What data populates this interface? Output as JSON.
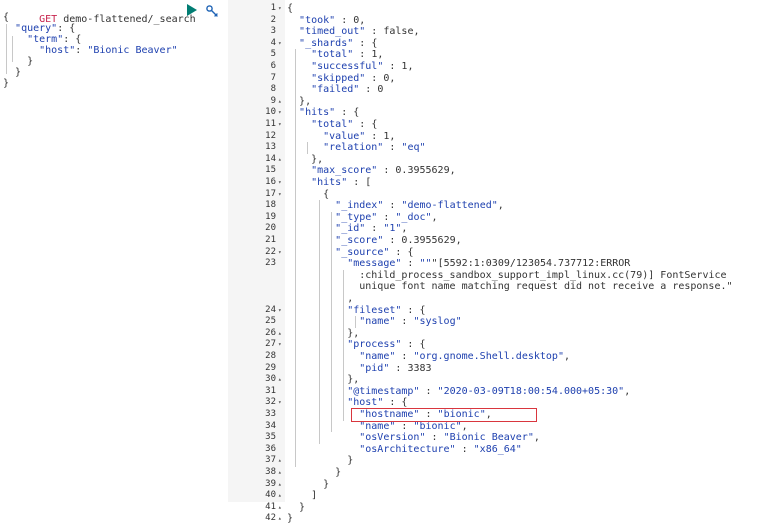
{
  "request": {
    "method": "GET",
    "endpoint": "demo-flattened/_search",
    "lines": [
      "{",
      "  \"query\": {",
      "    \"term\": {",
      "      \"host\": \"Bionic Beaver\"",
      "    }",
      "  }",
      "}"
    ]
  },
  "toolbar": {
    "run_icon": "play-icon",
    "settings_icon": "wrench-icon",
    "accent": "#017d73"
  },
  "response": {
    "lines": [
      {
        "n": "1",
        "fold": "▾",
        "text": "{"
      },
      {
        "n": "2",
        "fold": "",
        "text": "  \"took\" : 0,"
      },
      {
        "n": "3",
        "fold": "",
        "text": "  \"timed_out\" : false,"
      },
      {
        "n": "4",
        "fold": "▾",
        "text": "  \"_shards\" : {"
      },
      {
        "n": "5",
        "fold": "",
        "text": "    \"total\" : 1,"
      },
      {
        "n": "6",
        "fold": "",
        "text": "    \"successful\" : 1,"
      },
      {
        "n": "7",
        "fold": "",
        "text": "    \"skipped\" : 0,"
      },
      {
        "n": "8",
        "fold": "",
        "text": "    \"failed\" : 0"
      },
      {
        "n": "9",
        "fold": "▴",
        "text": "  },"
      },
      {
        "n": "10",
        "fold": "▾",
        "text": "  \"hits\" : {"
      },
      {
        "n": "11",
        "fold": "▾",
        "text": "    \"total\" : {"
      },
      {
        "n": "12",
        "fold": "",
        "text": "      \"value\" : 1,"
      },
      {
        "n": "13",
        "fold": "",
        "text": "      \"relation\" : \"eq\""
      },
      {
        "n": "14",
        "fold": "▴",
        "text": "    },"
      },
      {
        "n": "15",
        "fold": "",
        "text": "    \"max_score\" : 0.3955629,"
      },
      {
        "n": "16",
        "fold": "▾",
        "text": "    \"hits\" : ["
      },
      {
        "n": "17",
        "fold": "▾",
        "text": "      {"
      },
      {
        "n": "18",
        "fold": "",
        "text": "        \"_index\" : \"demo-flattened\","
      },
      {
        "n": "19",
        "fold": "",
        "text": "        \"_type\" : \"_doc\","
      },
      {
        "n": "20",
        "fold": "",
        "text": "        \"_id\" : \"1\","
      },
      {
        "n": "21",
        "fold": "",
        "text": "        \"_score\" : 0.3955629,"
      },
      {
        "n": "22",
        "fold": "▾",
        "text": "        \"_source\" : {"
      },
      {
        "n": "23",
        "fold": "",
        "text": "          \"message\" : \"\"\"[5592:1:0309/123054.737712:ERROR"
      },
      {
        "n": "",
        "fold": "",
        "text": "            :child_process_sandbox_support_impl_linux.cc(79)] FontService"
      },
      {
        "n": "",
        "fold": "",
        "text": "            unique font name matching request did not receive a response.\""
      },
      {
        "n": "",
        "fold": "",
        "text": "          ,"
      },
      {
        "n": "24",
        "fold": "▾",
        "text": "          \"fileset\" : {"
      },
      {
        "n": "25",
        "fold": "",
        "text": "            \"name\" : \"syslog\""
      },
      {
        "n": "26",
        "fold": "▴",
        "text": "          },"
      },
      {
        "n": "27",
        "fold": "▾",
        "text": "          \"process\" : {"
      },
      {
        "n": "28",
        "fold": "",
        "text": "            \"name\" : \"org.gnome.Shell.desktop\","
      },
      {
        "n": "29",
        "fold": "",
        "text": "            \"pid\" : 3383"
      },
      {
        "n": "30",
        "fold": "▴",
        "text": "          },"
      },
      {
        "n": "31",
        "fold": "",
        "text": "          \"@timestamp\" : \"2020-03-09T18:00:54.000+05:30\","
      },
      {
        "n": "32",
        "fold": "▾",
        "text": "          \"host\" : {"
      },
      {
        "n": "33",
        "fold": "",
        "text": "            \"hostname\" : \"bionic\","
      },
      {
        "n": "34",
        "fold": "",
        "text": "            \"name\" : \"bionic\","
      },
      {
        "n": "35",
        "fold": "",
        "text": "            \"osVersion\" : \"Bionic Beaver\","
      },
      {
        "n": "36",
        "fold": "",
        "text": "            \"osArchitecture\" : \"x86_64\""
      },
      {
        "n": "37",
        "fold": "▴",
        "text": "          }"
      },
      {
        "n": "38",
        "fold": "▴",
        "text": "        }"
      },
      {
        "n": "39",
        "fold": "▴",
        "text": "      }"
      },
      {
        "n": "40",
        "fold": "▴",
        "text": "    ]"
      },
      {
        "n": "41",
        "fold": "▴",
        "text": "  }"
      },
      {
        "n": "42",
        "fold": "▴",
        "text": "}"
      }
    ]
  }
}
